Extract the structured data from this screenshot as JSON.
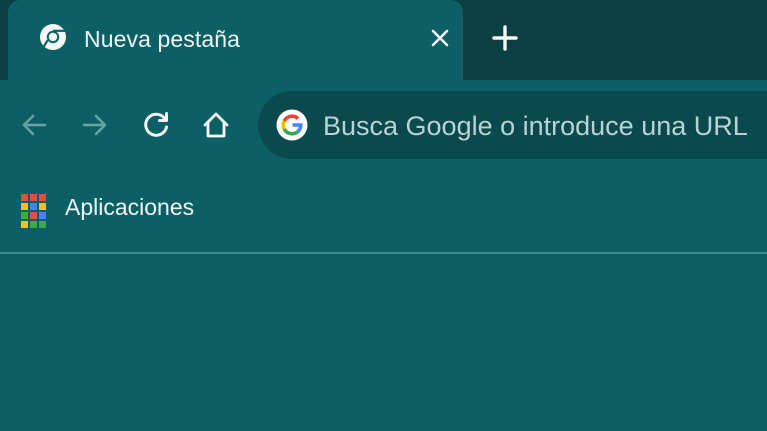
{
  "tab": {
    "title": "Nueva pestaña",
    "favicon": "chrome-icon",
    "close_icon": "close-icon"
  },
  "new_tab_icon": "plus-icon",
  "toolbar": {
    "back_icon": "back-arrow-icon",
    "forward_icon": "forward-arrow-icon",
    "reload_icon": "reload-icon",
    "home_icon": "home-icon"
  },
  "omnibox": {
    "placeholder": "Busca Google o introduce una URL",
    "icon": "google-g-icon"
  },
  "bookmarks": {
    "apps_label": "Aplicaciones",
    "apps_icon": "apps-grid-icon"
  },
  "colors": {
    "background": "#0c5f64",
    "tabstrip": "#0a3f44",
    "omnibox": "#0a4a4f",
    "text": "#eef6f6"
  }
}
